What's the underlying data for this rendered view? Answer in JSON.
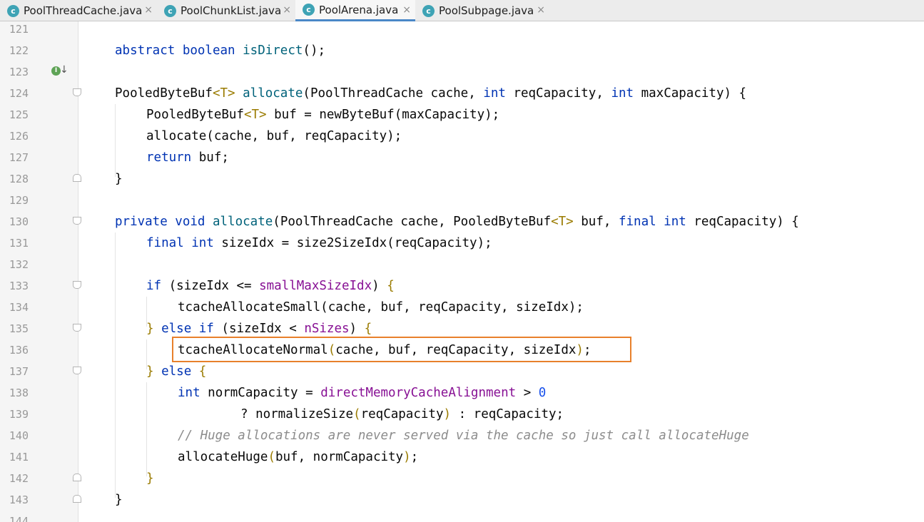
{
  "tabs": [
    {
      "label": "PoolThreadCache.java",
      "icon": "class-icon",
      "close": "×",
      "active": false
    },
    {
      "label": "PoolChunkList.java",
      "icon": "class-icon",
      "close": "×",
      "active": false
    },
    {
      "label": "PoolArena.java",
      "icon": "class-icon",
      "close": "×",
      "active": true
    },
    {
      "label": "PoolSubpage.java",
      "icon": "class-icon",
      "close": "×",
      "active": false
    }
  ],
  "tab_icon_glyph": "c",
  "gutter_marker": {
    "glyph": "I",
    "arrow": "↓",
    "line": 122
  },
  "line_numbers": [
    "121",
    "122",
    "123",
    "124",
    "125",
    "126",
    "127",
    "128",
    "129",
    "130",
    "131",
    "132",
    "133",
    "134",
    "135",
    "136",
    "137",
    "138",
    "139",
    "140",
    "141",
    "142",
    "143",
    "144"
  ],
  "code": {
    "l122_kw": "abstract boolean",
    "l122_fn": "isDirect",
    "l122_rest": "();",
    "l124_a": "PooledByteBuf",
    "l124_t": "<T>",
    "l124_fn": "allocate",
    "l124_b": "(PoolThreadCache cache,",
    "l124_kw1": "int",
    "l124_c": "reqCapacity,",
    "l124_kw2": "int",
    "l124_d": "maxCapacity) {",
    "l125_a": "PooledByteBuf",
    "l125_t": "<T>",
    "l125_b": "buf = newByteBuf(maxCapacity);",
    "l126": "allocate(cache, buf, reqCapacity);",
    "l127_kw": "return",
    "l127_rest": "buf;",
    "l128": "}",
    "l130_kw": "private void",
    "l130_fn": "allocate",
    "l130_a": "(PoolThreadCache cache, PooledByteBuf",
    "l130_t": "<T>",
    "l130_b": "buf,",
    "l130_kw2": "final int",
    "l130_c": "reqCapacity) {",
    "l131_kw": "final int",
    "l131_rest": "sizeIdx = size2SizeIdx(reqCapacity);",
    "l133_kw": "if",
    "l133_a": "(sizeIdx <=",
    "l133_fld": "smallMaxSizeIdx",
    "l133_b": ")",
    "l133_br": "{",
    "l134": "tcacheAllocateSmall(cache, buf, reqCapacity, sizeIdx);",
    "l135_br": "}",
    "l135_kw": "else if",
    "l135_a": "(sizeIdx <",
    "l135_fld": "nSizes",
    "l135_b": ")",
    "l135_br2": "{",
    "l136_a": "tcacheAllocateNormal",
    "l136_p": "(",
    "l136_b": "cache, buf, reqCapacity, sizeIdx",
    "l136_p2": ")",
    "l136_c": ";",
    "l137_br": "}",
    "l137_kw": "else",
    "l137_br2": "{",
    "l138_kw": "int",
    "l138_a": "normCapacity =",
    "l138_fld": "directMemoryCacheAlignment",
    "l138_b": ">",
    "l138_num": "0",
    "l139_a": "? normalizeSize",
    "l139_p": "(",
    "l139_b": "reqCapacity",
    "l139_p2": ")",
    "l139_c": ": reqCapacity;",
    "l140_cmt": "// Huge allocations are never served via the cache so just call allocateHuge",
    "l141_a": "allocateHuge",
    "l141_p": "(",
    "l141_b": "buf, normCapacity",
    "l141_p2": ")",
    "l141_c": ";",
    "l142_br": "}",
    "l143": "}"
  },
  "colors": {
    "keyword": "#0033b3",
    "method": "#00627a",
    "field": "#871094",
    "type_param": "#9a7b00",
    "comment": "#8c8c8c",
    "highlight_border": "#e8802b",
    "active_tab_underline": "#4a88c7"
  }
}
